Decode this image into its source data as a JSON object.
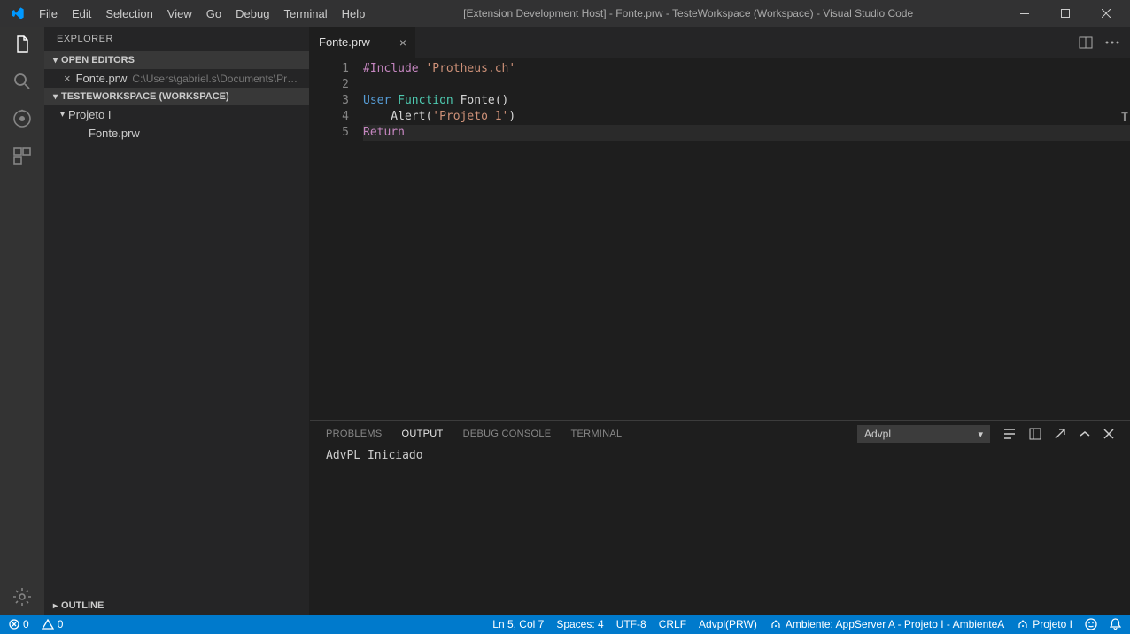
{
  "title": "[Extension Development Host] - Fonte.prw - TesteWorkspace (Workspace) - Visual Studio Code",
  "menu": [
    "File",
    "Edit",
    "Selection",
    "View",
    "Go",
    "Debug",
    "Terminal",
    "Help"
  ],
  "sidebar": {
    "title": "EXPLORER",
    "openEditors": "OPEN EDITORS",
    "workspace": "TESTEWORKSPACE (WORKSPACE)",
    "openFile": "Fonte.prw",
    "openFilePath": "C:\\Users\\gabriel.s\\Documents\\Projet...",
    "folder": "Projeto I",
    "fileInFolder": "Fonte.prw",
    "outline": "OUTLINE"
  },
  "tab": {
    "name": "Fonte.prw"
  },
  "code": {
    "lines": [
      {
        "n": "1",
        "t": [
          [
            "k1",
            "#Include"
          ],
          [
            "",
            " "
          ],
          [
            "str",
            "'Protheus.ch'"
          ]
        ]
      },
      {
        "n": "2",
        "t": [
          [
            "",
            ""
          ]
        ]
      },
      {
        "n": "3",
        "t": [
          [
            "k2",
            "User"
          ],
          [
            "",
            " "
          ],
          [
            "k3",
            "Function"
          ],
          [
            "",
            " "
          ],
          [
            "",
            "Fonte()"
          ]
        ]
      },
      {
        "n": "4",
        "t": [
          [
            "",
            "    Alert("
          ],
          [
            "str",
            "'Projeto 1'"
          ],
          [
            "",
            ")"
          ]
        ]
      },
      {
        "n": "5",
        "t": [
          [
            "k1",
            "Return"
          ]
        ],
        "current": true
      }
    ]
  },
  "panel": {
    "tabs": [
      "PROBLEMS",
      "OUTPUT",
      "DEBUG CONSOLE",
      "TERMINAL"
    ],
    "active": 1,
    "select": "Advpl",
    "output": "AdvPL Iniciado"
  },
  "status": {
    "errors": "0",
    "warnings": "0",
    "lncol": "Ln 5, Col 7",
    "spaces": "Spaces: 4",
    "encoding": "UTF-8",
    "eol": "CRLF",
    "lang": "Advpl(PRW)",
    "ambiente": "Ambiente: AppServer A - Projeto I - AmbienteA",
    "projeto": "Projeto I"
  }
}
